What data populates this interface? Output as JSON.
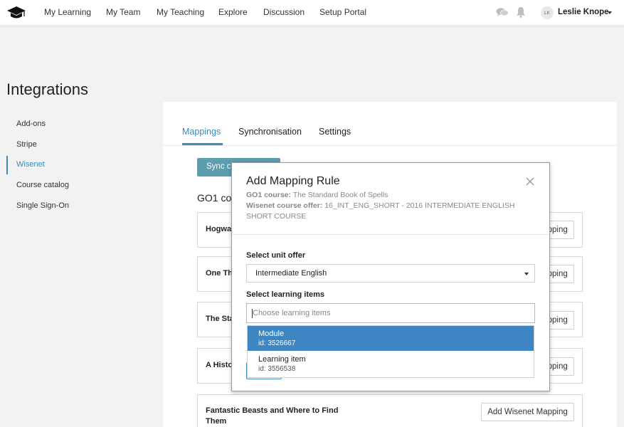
{
  "nav": {
    "items": [
      {
        "label": "My Learning"
      },
      {
        "label": "My Team"
      },
      {
        "label": "My Teaching"
      },
      {
        "label": "Explore"
      },
      {
        "label": "Discussion"
      },
      {
        "label": "Setup Portal"
      }
    ],
    "logo_icon": "graduation-cap-icon",
    "chat_icon": "chat-bubbles-icon",
    "bell_icon": "bell-icon",
    "avatar_initials": "LK",
    "user_name": "Leslie Knope"
  },
  "page": {
    "title": "Integrations"
  },
  "sidebar": {
    "items": [
      {
        "label": "Add-ons"
      },
      {
        "label": "Stripe"
      },
      {
        "label": "Wisenet"
      },
      {
        "label": "Course catalog"
      },
      {
        "label": "Single Sign-On"
      }
    ],
    "active_index": 2
  },
  "main": {
    "tabs": [
      {
        "label": "Mappings"
      },
      {
        "label": "Synchronisation"
      },
      {
        "label": "Settings"
      }
    ],
    "sync_button_label": "Sync courses",
    "section_title": "GO1 courses",
    "courses": [
      {
        "name": "Hogwarts",
        "button_label": "Add Wisenet Mapping"
      },
      {
        "name": "One Thousand",
        "button_label": "Add Wisenet Mapping"
      },
      {
        "name": "The Standard",
        "button_label": "Add Wisenet Mapping"
      },
      {
        "name": "A History",
        "button_label": "Add Wisenet Mapping"
      },
      {
        "name": "Fantastic Beasts and Where to Find Them",
        "button_label": "Add Wisenet Mapping"
      }
    ]
  },
  "modal": {
    "title": "Add Mapping Rule",
    "go1_course_label": "GO1 course:",
    "go1_course_value": "The Standard Book of Spells",
    "wisenet_offer_label": "Wisenet course offer:",
    "wisenet_offer_value": "16_INT_ENG_SHORT - 2016 INTERMEDIATE ENGLISH SHORT COURSE",
    "unit_offer_label": "Select unit offer",
    "unit_offer_selected": "Intermediate English",
    "learning_items_label": "Select learning items",
    "learning_items_placeholder": "Choose learning items",
    "options": [
      {
        "name": "Module",
        "id": "id: 3526667"
      },
      {
        "name": "Learning item",
        "id": "id: 3556538"
      }
    ],
    "close_icon": "close-icon",
    "colors": {
      "accent": "#3a8db4",
      "selected_option_bg": "#3e86c2",
      "sync_button_bg": "#5b9eb0"
    }
  }
}
